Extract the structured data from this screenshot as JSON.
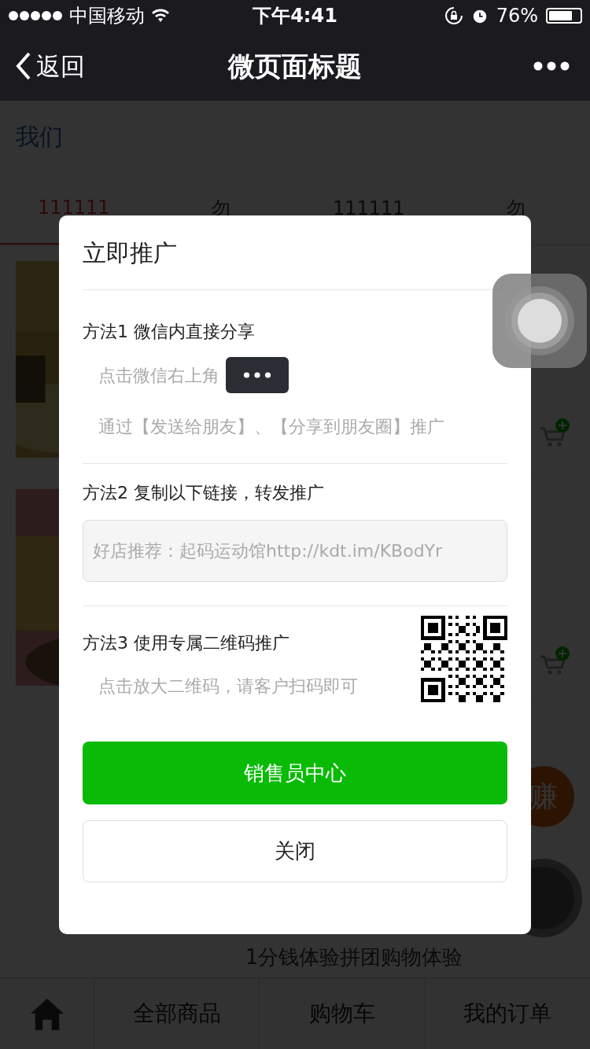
{
  "status_bar": {
    "carrier": "中国移动",
    "time": "下午4:41",
    "battery": "76%"
  },
  "nav_bar": {
    "back": "返回",
    "title": "微页面标题"
  },
  "page": {
    "heading": "我们",
    "tabs": [
      {
        "label": "111111",
        "selected": true
      },
      {
        "label": "勿",
        "selected": false
      },
      {
        "label": "111111",
        "selected": false
      },
      {
        "label": "勿",
        "selected": false
      }
    ],
    "badge": "赚",
    "product_title": "1分钱体验拼团购物体验"
  },
  "modal": {
    "title": "立即推广",
    "method_1": {
      "heading": "方法1 微信内直接分享",
      "hint": "点击微信右上角",
      "note": "通过【发送给朋友】、【分享到朋友圈】推广"
    },
    "method_2": {
      "heading": "方法2 复制以下链接，转发推广",
      "link": "好店推荐：起码运动馆http://kdt.im/KBodYr"
    },
    "method_3": {
      "heading": "方法3 使用专属二维码推广",
      "hint": "点击放大二维码，请客户扫码即可"
    },
    "primary_button": "销售员中心",
    "close_button": "关闭"
  },
  "tab_bar": {
    "items": [
      {
        "kind": "home"
      },
      {
        "kind": "text",
        "label": "全部商品"
      },
      {
        "kind": "text",
        "label": "购物车"
      },
      {
        "kind": "text",
        "label": "我的订单"
      }
    ]
  }
}
